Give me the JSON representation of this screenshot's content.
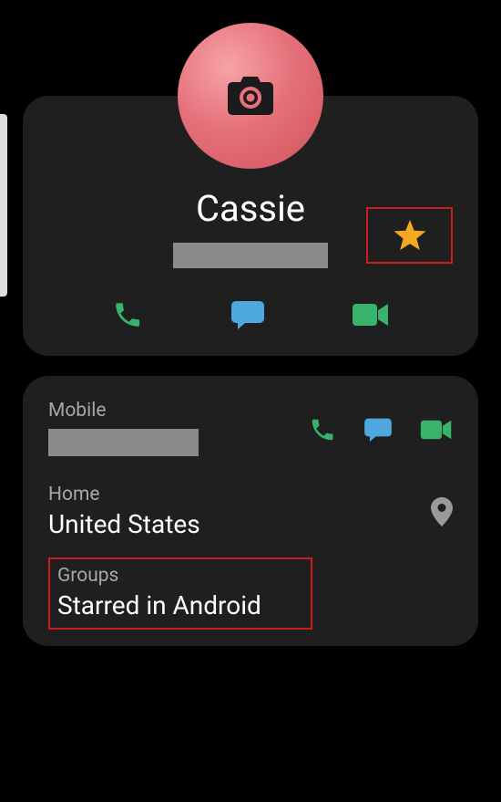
{
  "contact": {
    "name": "Cassie",
    "starred": true
  },
  "fields": {
    "mobile": {
      "label": "Mobile",
      "value": ""
    },
    "home": {
      "label": "Home",
      "value": "United States"
    },
    "groups": {
      "label": "Groups",
      "value": "Starred in Android"
    }
  },
  "icons": {
    "camera": "camera-icon",
    "star": "star-icon",
    "phone": "phone-icon",
    "message": "message-icon",
    "video": "video-icon",
    "location": "location-icon"
  },
  "colors": {
    "call": "#37b36b",
    "message": "#4fa9e0",
    "video": "#37b36b",
    "star": "#f3a91f",
    "location": "#9a9a9a"
  }
}
